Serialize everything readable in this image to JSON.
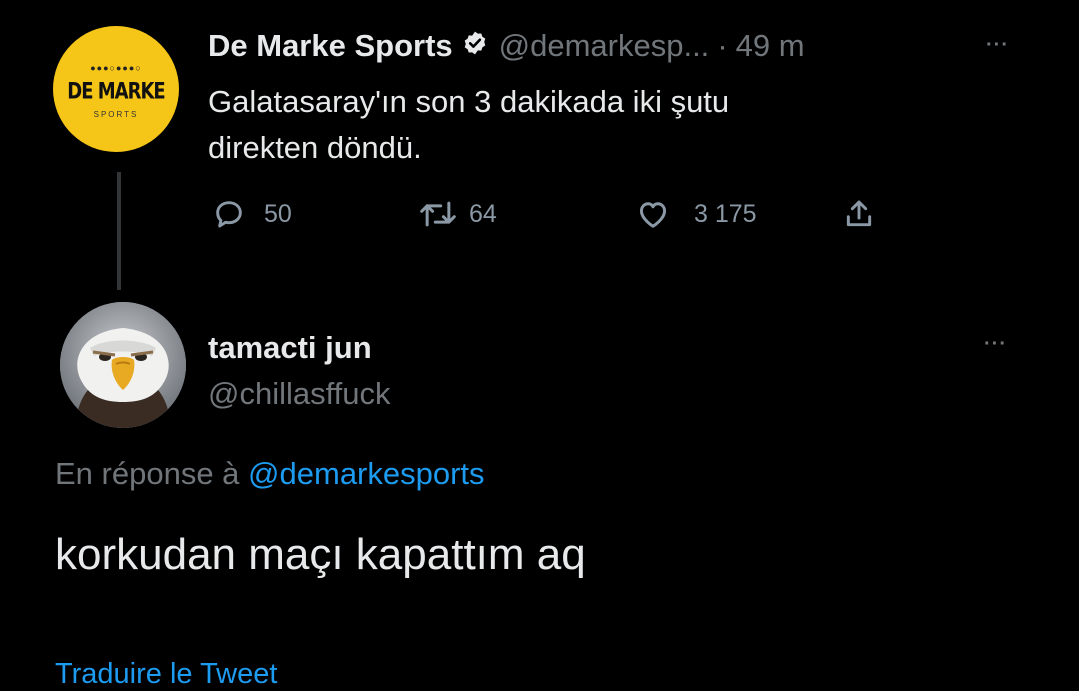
{
  "original_tweet": {
    "avatar": {
      "brand_main": "DE MARKE",
      "brand_sub": "SPORTS",
      "background_color": "#f5c518",
      "icon": "de-marke-sports-logo"
    },
    "display_name": "De Marke Sports",
    "verified": true,
    "handle": "@demarkesp...",
    "separator": "·",
    "time": "49 m",
    "more": "···",
    "text_line_1": "Galatasaray'ın son 3 dakikada iki şutu",
    "text_line_2": "direkten döndü.",
    "actions": {
      "reply_count": "50",
      "retweet_count": "64",
      "like_count": "3 175"
    }
  },
  "reply": {
    "avatar_icon": "eagle-avatar",
    "display_name": "tamacti jun",
    "handle": "@chillasffuck",
    "more": "···",
    "replying_prefix": "En réponse à",
    "replying_to": "@demarkesports",
    "text": "korkudan maçı kapattım aq",
    "translate_label": "Traduire le Tweet"
  },
  "colors": {
    "background": "#000000",
    "text": "#e7e9ea",
    "muted": "#71767b",
    "link": "#1d9bf0"
  }
}
